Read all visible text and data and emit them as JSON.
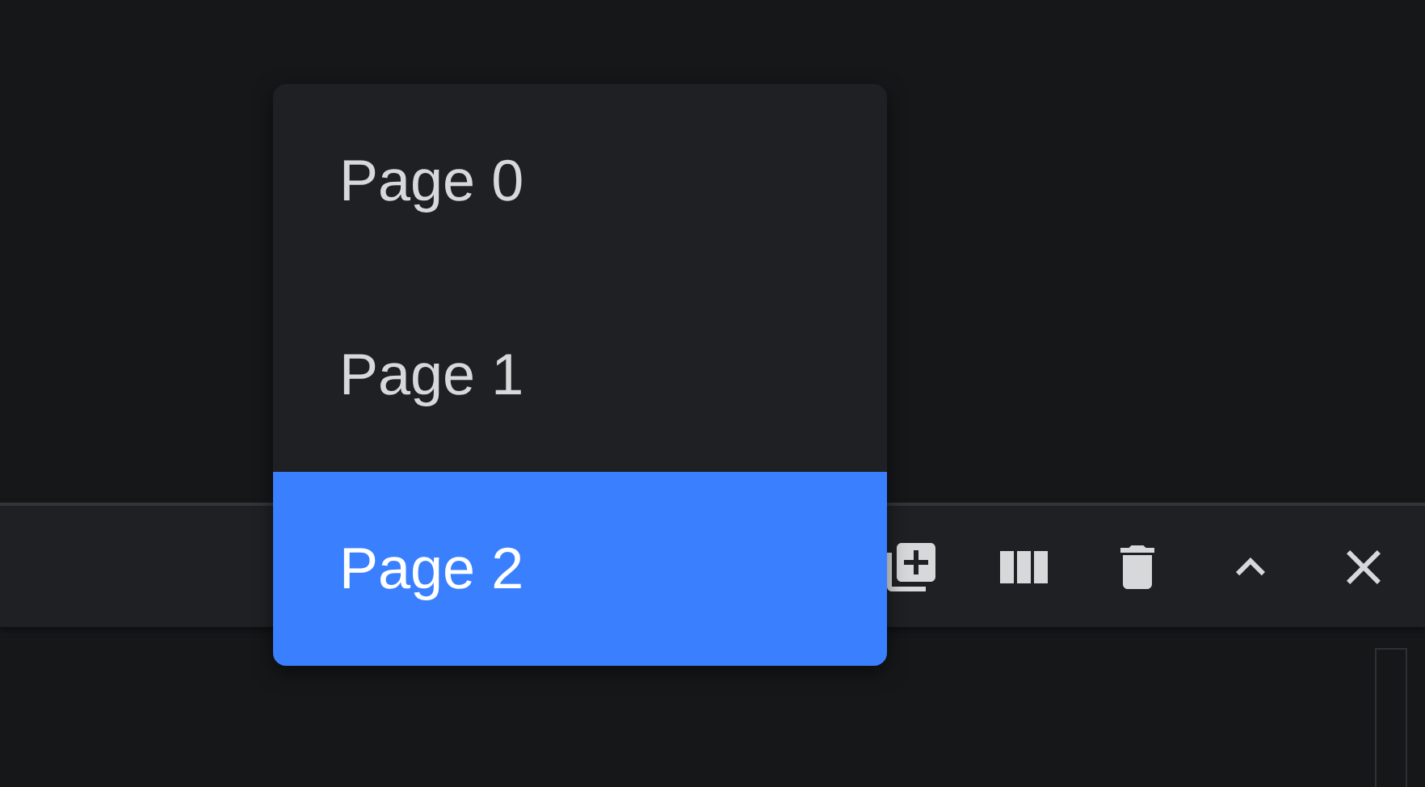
{
  "page_menu": {
    "items": [
      {
        "label": "Page 0",
        "selected": false
      },
      {
        "label": "Page 1",
        "selected": false
      },
      {
        "label": "Page 2",
        "selected": true
      }
    ]
  },
  "toolbar": {
    "buttons": [
      {
        "kind": "add-page"
      },
      {
        "kind": "columns"
      },
      {
        "kind": "delete"
      },
      {
        "kind": "collapse"
      },
      {
        "kind": "close"
      }
    ]
  }
}
